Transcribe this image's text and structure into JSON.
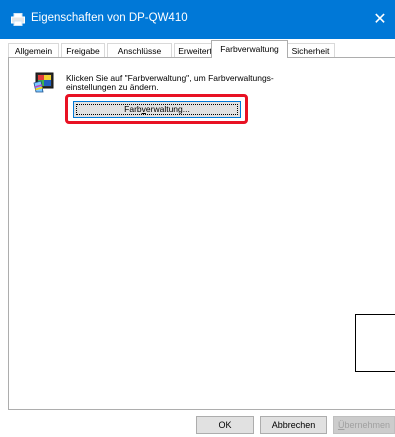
{
  "window": {
    "title": "Eigenschaften von DP-QW410",
    "title_icon": "printer-icon",
    "close_glyph": "✕",
    "accent_color": "#0078d7"
  },
  "tabs": [
    {
      "label": "Allgemein"
    },
    {
      "label": "Freigabe"
    },
    {
      "label": "Anschlüsse"
    },
    {
      "label": "Erweitert"
    },
    {
      "label": "Farbverwaltung",
      "active": true
    },
    {
      "label": "Sicherheit"
    }
  ],
  "color_management": {
    "icon": "color-management-icon",
    "info_line1": "Klicken Sie auf \"Farbverwaltung\", um Farbverwaltungs-",
    "info_line2": "einstellungen zu ändern.",
    "button_pre": "Farb",
    "button_mnemonic": "v",
    "button_post": "erwaltung...",
    "highlight_color": "#e81123"
  },
  "footer": {
    "ok": "OK",
    "cancel": "Abbrechen",
    "apply_mnemonic": "Ü",
    "apply_rest": "bernehmen"
  }
}
